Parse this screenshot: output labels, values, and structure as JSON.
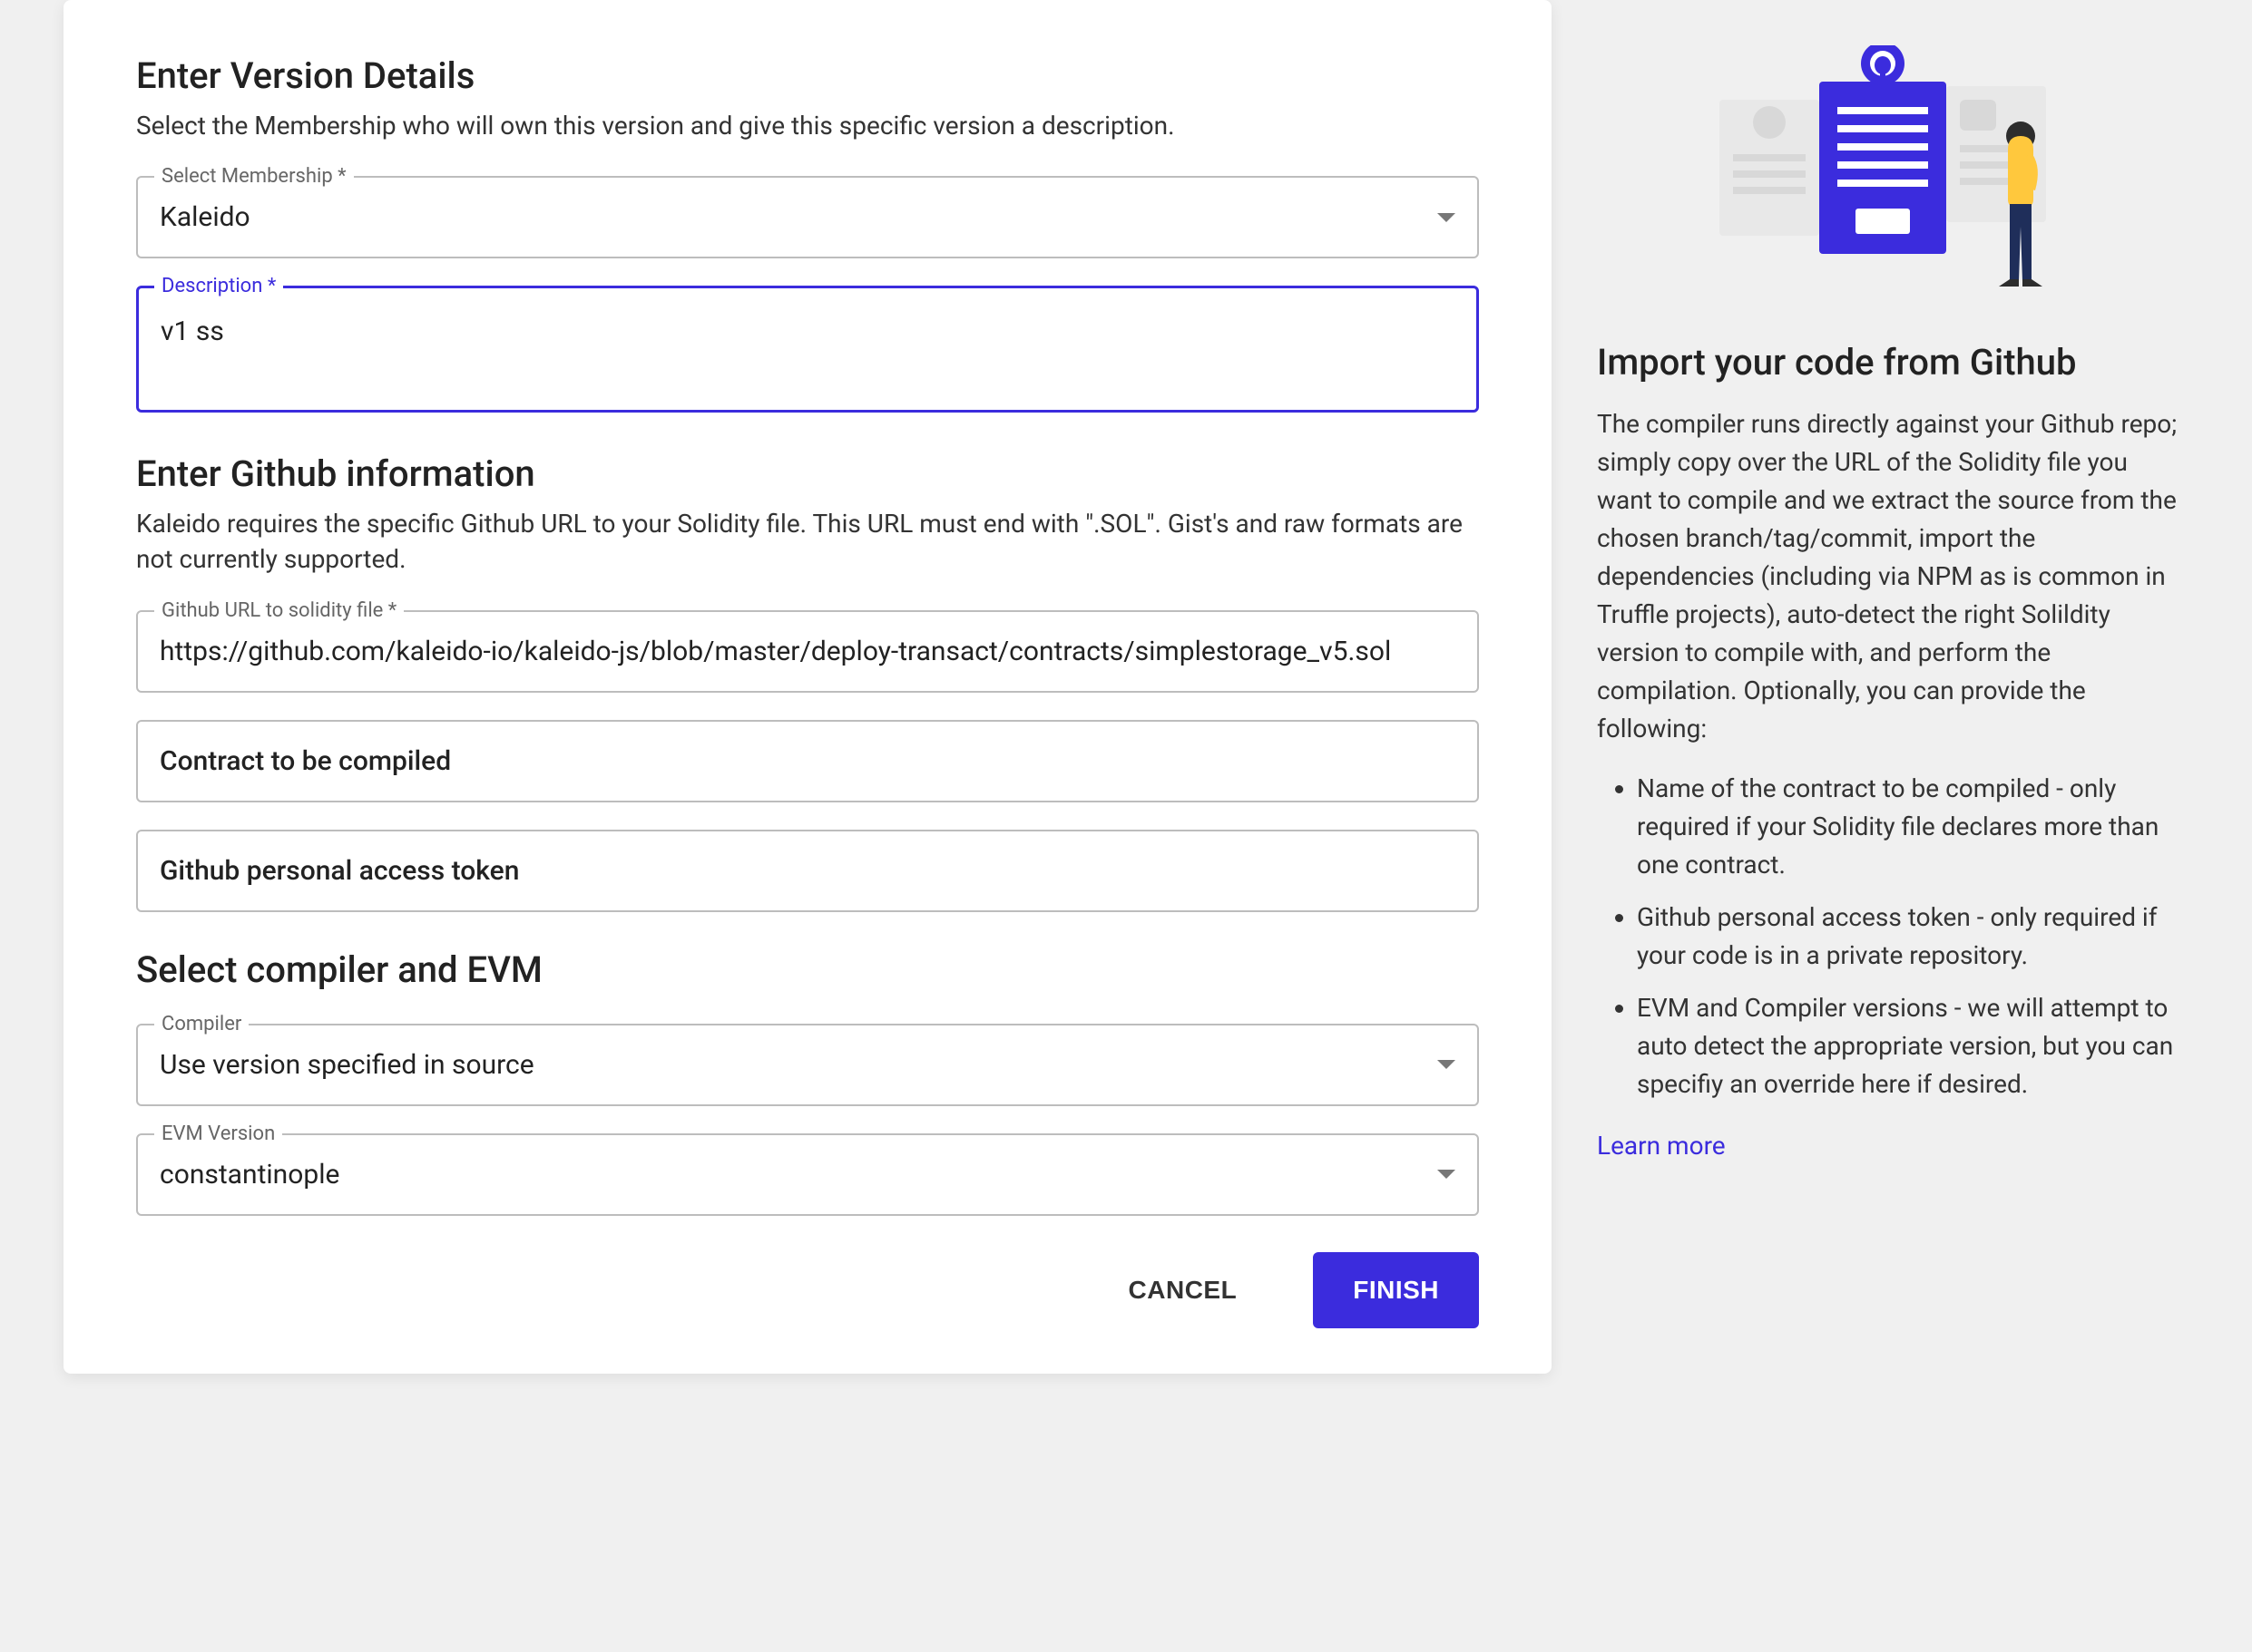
{
  "sections": {
    "version": {
      "heading": "Enter Version Details",
      "subhead": "Select the Membership who will own this version and give this specific version a description."
    },
    "github": {
      "heading": "Enter Github information",
      "subhead": "Kaleido requires the specific Github URL to your Solidity file. This URL must end with \".SOL\". Gist's and raw formats are not currently supported."
    },
    "compiler": {
      "heading": "Select compiler and EVM"
    }
  },
  "fields": {
    "membership": {
      "label": "Select Membership *",
      "value": "Kaleido"
    },
    "description": {
      "label": "Description *",
      "value": "v1 ss"
    },
    "githubUrl": {
      "label": "Github URL to solidity file *",
      "value": "https://github.com/kaleido-io/kaleido-js/blob/master/deploy-transact/contracts/simplestorage_v5.sol"
    },
    "contract": {
      "placeholder": "Contract to be compiled",
      "value": ""
    },
    "token": {
      "placeholder": "Github personal access token",
      "value": ""
    },
    "compiler": {
      "label": "Compiler",
      "value": "Use version specified in source"
    },
    "evm": {
      "label": "EVM Version",
      "value": "constantinople"
    }
  },
  "actions": {
    "cancel": "CANCEL",
    "finish": "FINISH"
  },
  "side": {
    "title": "Import your code from Github",
    "paragraph": "The compiler runs directly against your Github repo; simply copy over the URL of the Solidity file you want to compile and we extract the source from the chosen branch/tag/commit, import the dependencies (including via NPM as is common in Truffle projects), auto-detect the right Solildity version to compile with, and perform the compilation. Optionally, you can provide the following:",
    "bullets": [
      "Name of the contract to be compiled - only required if your Solidity file declares more than one contract.",
      "Github personal access token - only required if your code is in a private repository.",
      "EVM and Compiler versions - we will attempt to auto detect the appropriate version, but you can specifiy an override here if desired."
    ],
    "link": "Learn more"
  }
}
